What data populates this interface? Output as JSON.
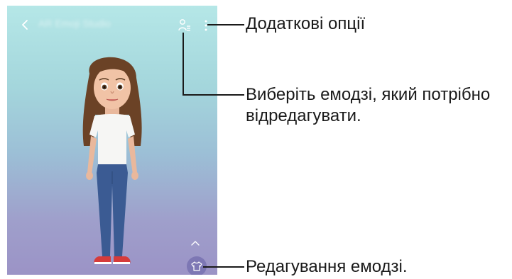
{
  "screen": {
    "title": "AR Emoji Studio",
    "colors": {
      "bg_top": "#b5e7e7",
      "bg_bottom": "#9b93c6",
      "accent_button": "#7d77b4",
      "callout_line": "#1a1a1a"
    },
    "icons": {
      "back": "chevron-left-icon",
      "select_emoji": "person-list-icon",
      "more": "more-vertical-icon",
      "expand": "chevron-up-icon",
      "edit": "tshirt-icon"
    }
  },
  "callouts": {
    "more_options": "Додаткові опції",
    "select_emoji_line1": "Виберіть емодзі, який потрібно",
    "select_emoji_line2": "відредагувати.",
    "edit_emoji": "Редагування емодзі."
  }
}
